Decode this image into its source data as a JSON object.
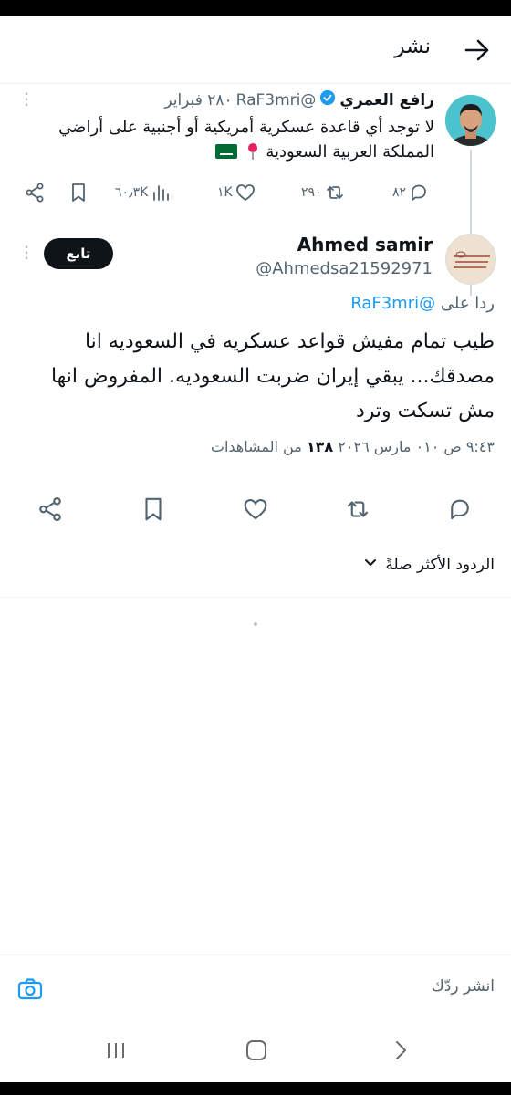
{
  "header": {
    "title": "نشر"
  },
  "parent_tweet": {
    "name": "رافع العمري",
    "handle": "@RaF3mri",
    "date": "٢٨٠ فبراير",
    "text_line1": "لا توجد أي قاعدة عسكرية أمريكية أو أجنبية على أراضي",
    "text_line2": "المملكة العربية السعودية",
    "replies": "٨٢",
    "reposts": "٢٩٠",
    "likes": "١K",
    "views": "٦٠٫٣K"
  },
  "main_tweet": {
    "name": "Ahmed samir",
    "handle": "@Ahmedsa21592971",
    "follow_label": "تابع",
    "reply_prefix": "ردا على",
    "reply_mention": "@RaF3mri",
    "text": "طيب تمام مفيش قواعد عسكريه في السعوديه انا مصدقك... يبقي إيران ضربت السعوديه. المفروض انها مش تسكت وترد",
    "time": "٩:٤٣ ص ٠١٠ مارس ٢٠٢٦",
    "views_count": "١٣٨",
    "views_label": "من المشاهدات"
  },
  "sort": {
    "label": "الردود الأكثر صلةً"
  },
  "reply_bar": {
    "placeholder": "انشر ردّك"
  },
  "colors": {
    "accent": "#1d9bf0",
    "text": "#0f1419",
    "muted": "#536471"
  }
}
